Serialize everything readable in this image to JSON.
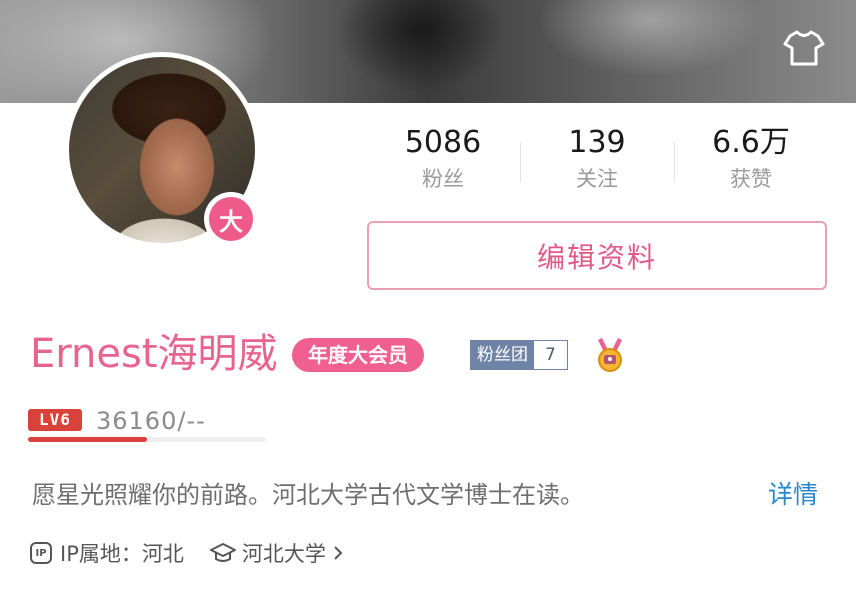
{
  "profile": {
    "name": "Ernest海明威",
    "avatar_badge": "大",
    "vip_badge": "年度大会员",
    "fan_club": {
      "label": "粉丝团",
      "count": "7"
    },
    "level": {
      "badge": "LV6",
      "experience": "36160/--",
      "progress": 0.5
    },
    "bio": "愿星光照耀你的前路。河北大学古代文学博士在读。",
    "details_link": "详情",
    "ip_icon_text": "IP",
    "ip_location": "IP属地：河北",
    "school": "河北大学",
    "colors": {
      "accent": "#e8648f",
      "vip": "#ef5f90",
      "level": "#d9423b",
      "link": "#2a87c9",
      "fan_club": "#6f83a6"
    }
  },
  "stats": [
    {
      "value": "5086",
      "label": "粉丝"
    },
    {
      "value": "139",
      "label": "关注"
    },
    {
      "value": "6.6万",
      "label": "获赞"
    }
  ],
  "actions": {
    "edit_profile": "编辑资料"
  },
  "icons": {
    "top_right": "t-shirt-icon",
    "ip": "ip-icon",
    "school": "graduation-cap-icon",
    "chevron": "chevron-right-icon",
    "medal": "medal-icon"
  }
}
